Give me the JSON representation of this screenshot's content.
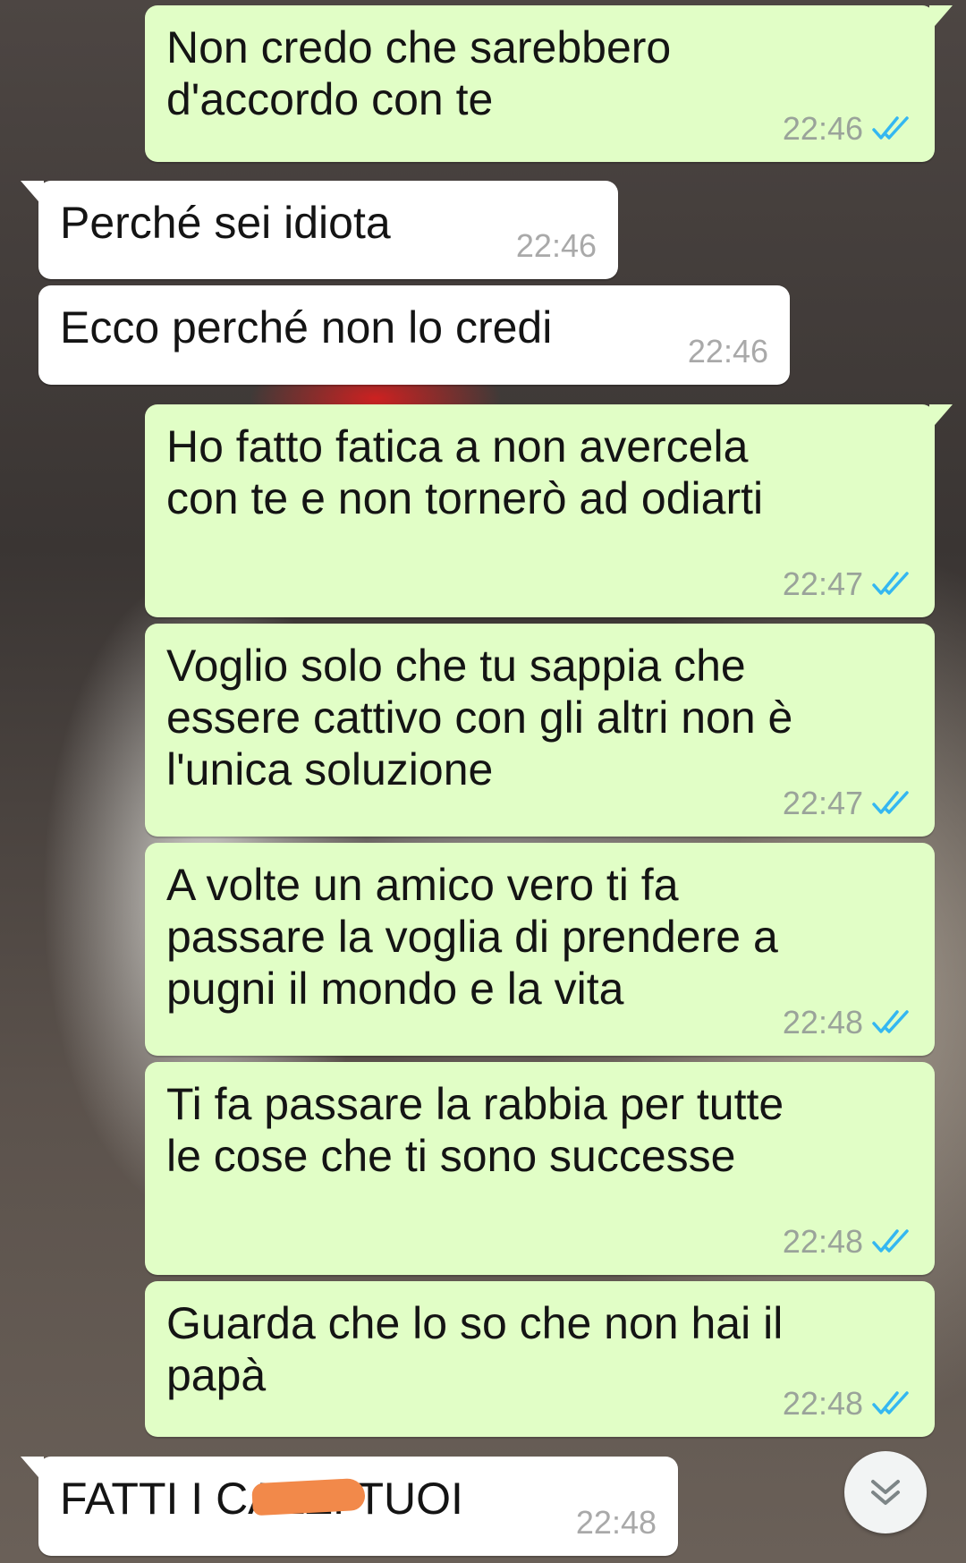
{
  "messages": [
    {
      "direction": "out",
      "text": "Non credo che sarebbero\nd'accordo con te",
      "time": "22:46",
      "status": "read-double-check"
    },
    {
      "direction": "in",
      "text": "Perché sei idiota",
      "time": "22:46"
    },
    {
      "direction": "in",
      "text": "Ecco perché non lo credi",
      "time": "22:46"
    },
    {
      "direction": "out",
      "text": "Ho fatto fatica a non avercela\ncon te e non tornerò ad odiarti",
      "time": "22:47",
      "status": "read-double-check"
    },
    {
      "direction": "out",
      "text": "Voglio solo che tu sappia che\nessere cattivo con gli altri non è\nl'unica soluzione",
      "time": "22:47",
      "status": "read-double-check"
    },
    {
      "direction": "out",
      "text": "A volte un amico vero ti fa\npassare la voglia di prendere a\npugni il mondo e la vita",
      "time": "22:48",
      "status": "read-double-check"
    },
    {
      "direction": "out",
      "text": "Ti fa passare la rabbia per tutte\nle cose che ti sono successe",
      "time": "22:48",
      "status": "read-double-check"
    },
    {
      "direction": "out",
      "text": "Guarda che lo so che non hai il\npapà",
      "time": "22:48",
      "status": "read-double-check"
    },
    {
      "direction": "in",
      "text": "FATTI I CAZZI TUOI",
      "time": "22:48"
    }
  ],
  "colors": {
    "outgoing_bubble": "#e1fec6",
    "incoming_bubble": "#ffffff",
    "read_check": "#34b7f1",
    "timestamp": "#9aa39a"
  },
  "icons": {
    "read_receipt": "double-check-icon",
    "scroll_down": "chevron-double-down-icon"
  }
}
